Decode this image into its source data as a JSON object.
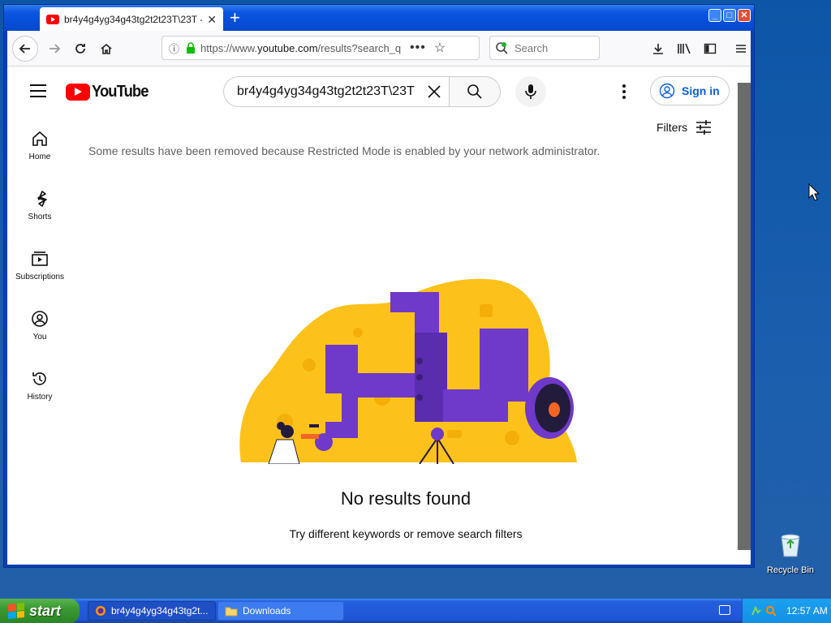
{
  "browser": {
    "tab_title": "br4y4g4yg34g43tg2t2t23T\\23T -",
    "url_prefix": "https://www.",
    "url_domain": "youtube.com",
    "url_path": "/results?search_q",
    "search_placeholder": "Search"
  },
  "youtube": {
    "logo_text": "YouTube",
    "search_value": "br4y4g4yg34g43tg2t2t23T\\23T",
    "sign_in": "Sign in",
    "filters": "Filters",
    "sidebar": [
      {
        "label": "Home",
        "icon": "home-icon"
      },
      {
        "label": "Shorts",
        "icon": "shorts-icon"
      },
      {
        "label": "Subscriptions",
        "icon": "subscriptions-icon"
      },
      {
        "label": "You",
        "icon": "you-icon"
      },
      {
        "label": "History",
        "icon": "history-icon"
      }
    ],
    "notice": "Some results have been removed because Restricted Mode is enabled by your network administrator.",
    "no_results": "No results found",
    "hint": "Try different keywords or remove search filters"
  },
  "desktop": {
    "recycle_bin": "Recycle Bin"
  },
  "taskbar": {
    "start": "start",
    "tasks": [
      {
        "label": "br4y4g4yg34g43tg2t..."
      },
      {
        "label": "Downloads"
      }
    ],
    "clock": "12:57 AM"
  },
  "colors": {
    "youtube_red": "#ff0000",
    "link_blue": "#065fd4",
    "illustration_yellow": "#fcc21b",
    "illustration_purple": "#6f39c9"
  }
}
